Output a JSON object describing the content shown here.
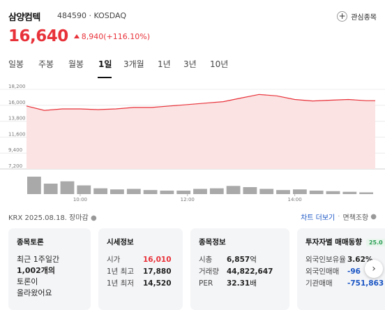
{
  "header": {
    "name": "삼양컴텍",
    "code": "484590 · KOSDAQ",
    "watch_label": "관심종목"
  },
  "quote": {
    "price": "16,640",
    "change": "8,940(+116.10%)"
  },
  "tabs": [
    {
      "label": "일봉"
    },
    {
      "label": "주봉"
    },
    {
      "label": "월봉"
    },
    {
      "label": "1일",
      "active": true
    },
    {
      "label": "3개월"
    },
    {
      "label": "1년"
    },
    {
      "label": "3년"
    },
    {
      "label": "10년"
    }
  ],
  "chart_data": {
    "type": "area",
    "y_ticks": [
      "18,200",
      "16,000",
      "13,800",
      "11,600",
      "9,400",
      "7,200"
    ],
    "ylim": [
      7200,
      18200
    ],
    "x_ticks": [
      "10:00",
      "12:00",
      "14:00"
    ],
    "xlim": [
      "09:00",
      "15:30"
    ],
    "times": [
      "09:00",
      "09:20",
      "09:40",
      "10:00",
      "10:20",
      "10:40",
      "11:00",
      "11:20",
      "11:40",
      "12:00",
      "12:20",
      "12:40",
      "13:00",
      "13:20",
      "13:40",
      "14:00",
      "14:20",
      "14:40",
      "15:00",
      "15:20",
      "15:30"
    ],
    "values": [
      15900,
      15300,
      15500,
      15500,
      15400,
      15500,
      15700,
      15700,
      15900,
      16100,
      16300,
      16500,
      17000,
      17500,
      17300,
      16800,
      16600,
      16700,
      16800,
      16640,
      16640
    ],
    "volume": [
      30,
      18,
      22,
      15,
      10,
      8,
      9,
      7,
      6,
      6,
      9,
      10,
      14,
      12,
      9,
      7,
      8,
      6,
      5,
      4,
      3
    ],
    "grid": true,
    "line_color": "#e8323a",
    "fill_color": "#fbe3e3"
  },
  "status": {
    "market": "KRX",
    "date": "2025.08.18. 장마감",
    "chart_more": "차트 더보기",
    "disclaimer": "면책조항"
  },
  "cards": {
    "discussion": {
      "title": "종목토론",
      "line1": "최근 1주일간",
      "count": "1,002개의",
      "line3": "토론이",
      "line4": "올라왔어요"
    },
    "market_info": {
      "title": "시세정보",
      "rows": [
        {
          "k": "시가",
          "v": "16,010"
        },
        {
          "k": "1년 최고",
          "v": "17,880"
        },
        {
          "k": "1년 최저",
          "v": "14,520"
        }
      ]
    },
    "stock_info": {
      "title": "종목정보",
      "rows": [
        {
          "k": "시총",
          "v": "6,857",
          "unit": "억"
        },
        {
          "k": "거래량",
          "v": "44,822,647"
        },
        {
          "k": "PER",
          "v": "32.31",
          "unit": "배"
        }
      ]
    },
    "investor": {
      "title": "투자자별 매매동향",
      "badge": "25.0",
      "rows": [
        {
          "k": "외국인보유율",
          "v": "3.62%"
        },
        {
          "k": "외국인매매",
          "v": "-96"
        },
        {
          "k": "기관매매",
          "v": "-751,863"
        }
      ]
    }
  }
}
